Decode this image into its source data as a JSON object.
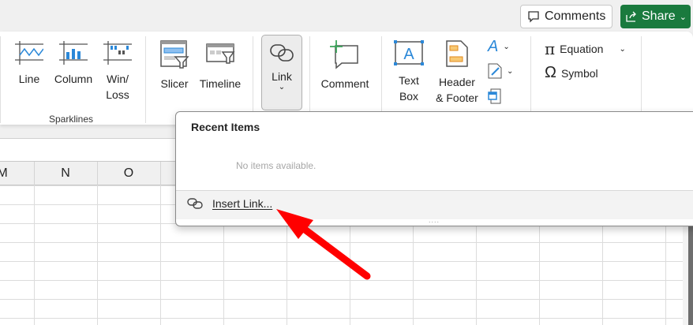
{
  "topbar": {
    "comments_label": "Comments",
    "share_label": "Share"
  },
  "ribbon": {
    "sparklines": {
      "line": "Line",
      "column": "Column",
      "winloss_1": "Win/",
      "winloss_2": "Loss",
      "group_label": "Sparklines"
    },
    "filters": {
      "slicer": "Slicer",
      "timeline": "Timeline"
    },
    "links": {
      "link": "Link"
    },
    "comments": {
      "comment": "Comment"
    },
    "text": {
      "textbox_1": "Text",
      "textbox_2": "Box",
      "header_1": "Header",
      "header_2": "& Footer"
    },
    "symbols": {
      "equation": "Equation",
      "symbol": "Symbol"
    }
  },
  "grid": {
    "columns": [
      "M",
      "N",
      "O"
    ]
  },
  "dropdown": {
    "title": "Recent Items",
    "empty": "No items available.",
    "insert_link": "Insert Link..."
  },
  "colors": {
    "share": "#1a7a3e",
    "annotation_arrow": "#ff0000",
    "icon_blue": "#2b88d8"
  }
}
